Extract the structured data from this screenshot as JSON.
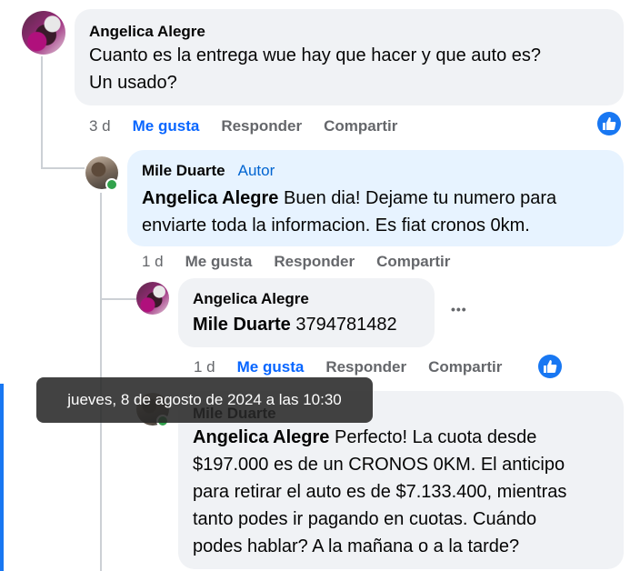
{
  "comments": [
    {
      "author": "Angelica Alegre",
      "text_lines": [
        "Cuanto es la entrega wue hay que hacer y que auto es?",
        "Un usado?"
      ],
      "time": "3 d",
      "like": "Me gusta",
      "reply": "Responder",
      "share": "Compartir"
    },
    {
      "author": "Mile Duarte",
      "author_tag": "Autor",
      "mention": "Angelica Alegre",
      "text_line1": " Buen dia! Dejame tu numero para",
      "text_line2": "enviarte toda la informacion. Es fiat cronos 0km.",
      "time": "1 d",
      "like": "Me gusta",
      "reply": "Responder",
      "share": "Compartir"
    },
    {
      "author": "Angelica Alegre",
      "mention": "Mile Duarte",
      "text": " 3794781482",
      "more": "•••",
      "time": "1 d",
      "like": "Me gusta",
      "reply": "Responder",
      "share": "Compartir"
    },
    {
      "author": "Mile Duarte",
      "mention": "Angelica Alegre",
      "text_line1": " Perfecto! La cuota desde",
      "text_line2": "$197.000 es de un CRONOS 0KM. El anticipo",
      "text_line3": "para retirar el auto es de $7.133.400, mientras",
      "text_line4": "tanto podes ir pagando en cuotas. Cuándo",
      "text_line5": "podes hablar? A la mañana o a la tarde?"
    }
  ],
  "tooltip": "jueves, 8 de agosto de 2024 a las 10:30",
  "colors": {
    "accent": "#0866ff",
    "like_badge": "#1877f2",
    "bubble": "#f0f2f5",
    "author_bubble": "#e7f3ff"
  },
  "icons": {
    "like": "thumbs-up-icon"
  }
}
